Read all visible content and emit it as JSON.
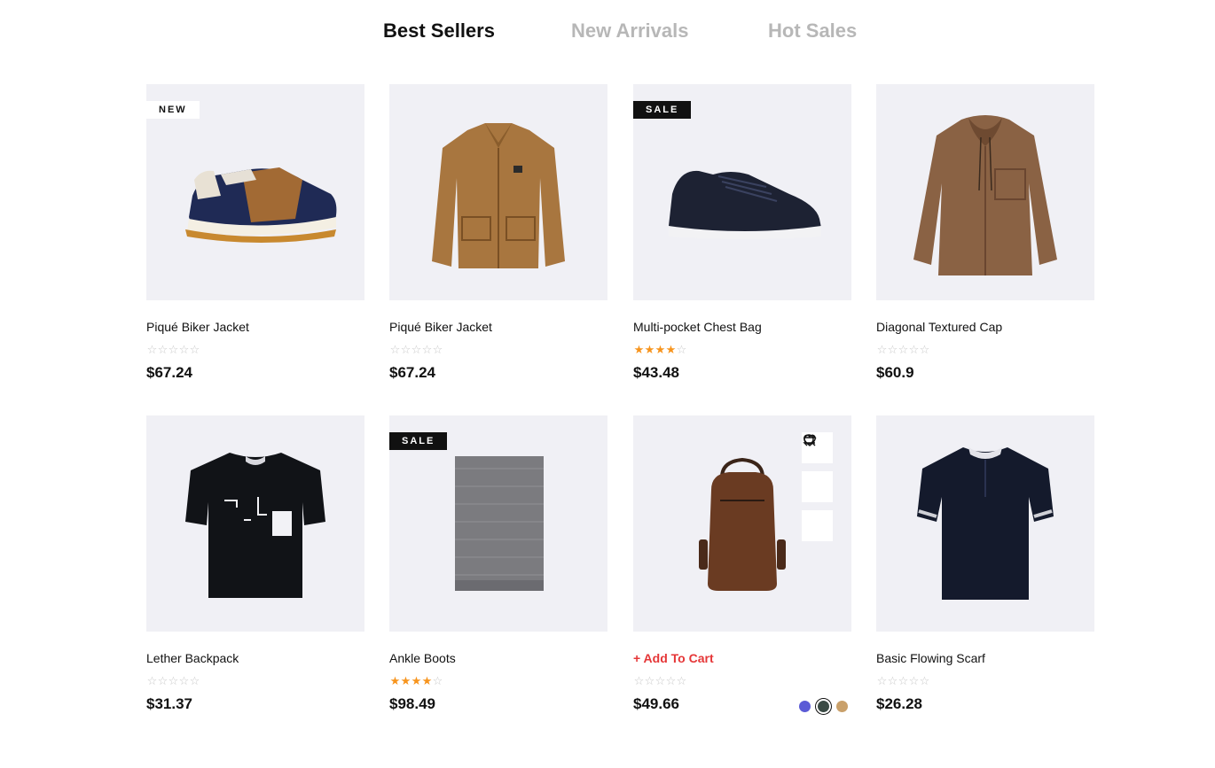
{
  "tabs": [
    {
      "label": "Best Sellers",
      "active": true
    },
    {
      "label": "New Arrivals",
      "active": false
    },
    {
      "label": "Hot Sales",
      "active": false
    }
  ],
  "products": [
    {
      "name": "Piqué Biker Jacket",
      "price": "$67.24",
      "rating": 0,
      "badge": "NEW",
      "image": "sneaker-icon"
    },
    {
      "name": "Piqué Biker Jacket",
      "price": "$67.24",
      "rating": 0,
      "badge": "",
      "image": "jacket-icon"
    },
    {
      "name": "Multi-pocket Chest Bag",
      "price": "$43.48",
      "rating": 4,
      "badge": "SALE",
      "image": "shoe-icon"
    },
    {
      "name": "Diagonal Textured Cap",
      "price": "$60.9",
      "rating": 0,
      "badge": "",
      "image": "shirt-icon"
    },
    {
      "name": "Lether Backpack",
      "price": "$31.37",
      "rating": 0,
      "badge": "",
      "image": "tshirt-icon"
    },
    {
      "name": "Ankle Boots",
      "price": "$98.49",
      "rating": 4,
      "badge": "SALE",
      "image": "scarf-icon"
    },
    {
      "name": "+ Add To Cart",
      "price": "$49.66",
      "rating": 0,
      "badge": "",
      "image": "backpack-icon",
      "hovered": true
    },
    {
      "name": "Basic Flowing Scarf",
      "price": "$26.28",
      "rating": 0,
      "badge": "",
      "image": "polo-icon"
    }
  ],
  "hover_actions": [
    "heart-icon",
    "compare-icon",
    "search-icon"
  ],
  "swatch_colors": [
    "#5b5bd6",
    "#3a4a44",
    "#c9a06a"
  ],
  "colors": {
    "accent": "#e53637",
    "star": "#f7941d",
    "thumb_bg": "#f0f0f5"
  }
}
